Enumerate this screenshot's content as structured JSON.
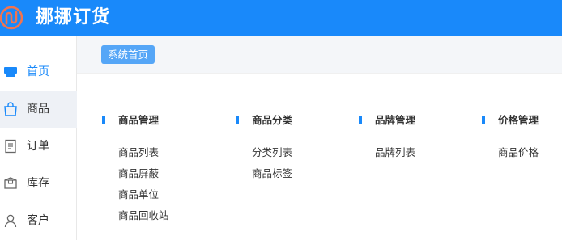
{
  "app": {
    "title": "挪挪订货"
  },
  "sidebar": {
    "items": [
      {
        "label": "首页"
      },
      {
        "label": "商品"
      },
      {
        "label": "订单"
      },
      {
        "label": "库存"
      },
      {
        "label": "客户"
      }
    ]
  },
  "breadcrumb": {
    "tab": "系统首页"
  },
  "groups": [
    {
      "title": "商品管理",
      "links": [
        "商品列表",
        "商品屏蔽",
        "商品单位",
        "商品回收站"
      ]
    },
    {
      "title": "商品分类",
      "links": [
        "分类列表",
        "商品标签"
      ]
    },
    {
      "title": "品牌管理",
      "links": [
        "品牌列表"
      ]
    },
    {
      "title": "价格管理",
      "links": [
        "商品价格"
      ]
    }
  ],
  "colors": {
    "header": "#1989fa",
    "accent": "#1989fa",
    "logo": "#f2744f"
  }
}
